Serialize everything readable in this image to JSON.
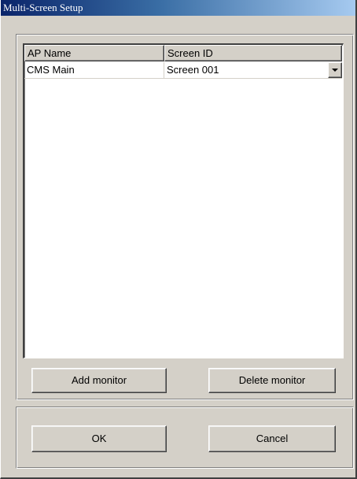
{
  "window": {
    "title": "Multi-Screen Setup"
  },
  "list": {
    "columns": [
      "AP Name",
      "Screen ID"
    ],
    "rows": [
      {
        "ap_name": "CMS Main",
        "screen_id": "Screen 001"
      }
    ]
  },
  "buttons": {
    "add_monitor": "Add monitor",
    "delete_monitor": "Delete monitor",
    "ok": "OK",
    "cancel": "Cancel"
  },
  "colors": {
    "face": "#d4d0c8",
    "title_start": "#0a246a",
    "title_end": "#a6caf0",
    "list_background": "#ffffff"
  },
  "icons": {
    "dropdown": "chevron-down-icon"
  }
}
